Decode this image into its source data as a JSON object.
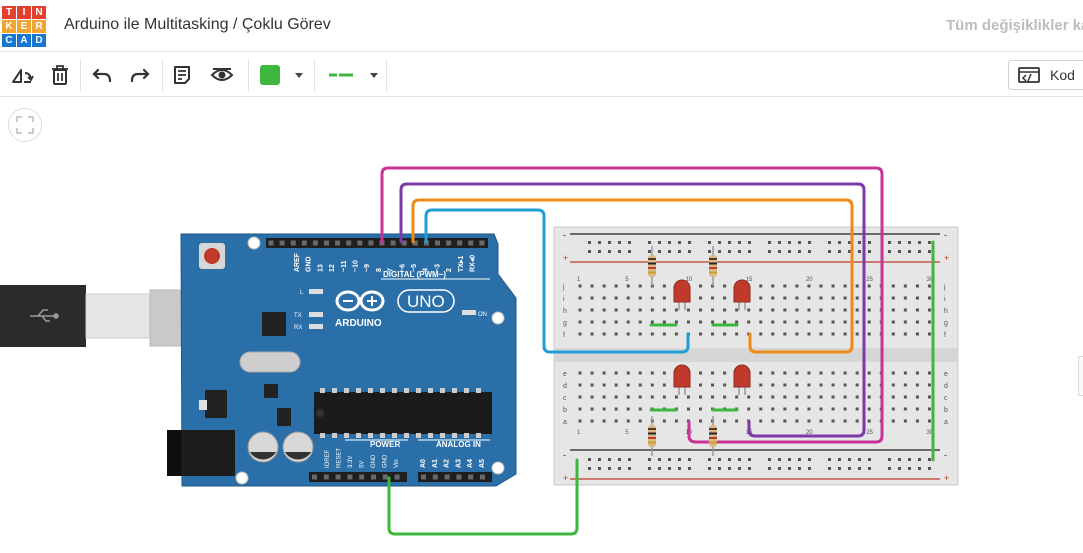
{
  "header": {
    "logo_letters": [
      "T",
      "I",
      "N",
      "K",
      "E",
      "R",
      "C",
      "A",
      "D"
    ],
    "logo_colors": [
      "#e2412f",
      "#e2412f",
      "#e2412f",
      "#f0a530",
      "#f0a530",
      "#f0a530",
      "#1477d1",
      "#1477d1",
      "#1477d1"
    ],
    "title": "Arduino ile Multitasking / Çoklu Görev",
    "save_status": "Tüm değişiklikler ka"
  },
  "toolbar": {
    "tools": [
      {
        "name": "rotate-icon"
      },
      {
        "name": "trash-icon"
      },
      {
        "name": "undo-icon"
      },
      {
        "name": "redo-icon"
      },
      {
        "name": "notes-icon"
      },
      {
        "name": "eye-icon"
      }
    ],
    "wire_color": "#3fb73f",
    "wire_style": "line-icon",
    "code_label": "Kod"
  },
  "arduino": {
    "board_color": "#2a6fa8",
    "label_brand": "ARDUINO",
    "label_model": "UNO",
    "header_digital": "DIGITAL (PWM~)",
    "digital_pins": [
      "AREF",
      "GND",
      "13",
      "12",
      "~11",
      "~10",
      "~9",
      "8",
      "7",
      "~6",
      "~5",
      "4",
      "~3",
      "2",
      "TX▸1",
      "RX◂0"
    ],
    "header_power": "POWER",
    "power_pins": [
      "IOREF",
      "RESET",
      "3.3V",
      "5V",
      "GND",
      "GND",
      "Vin"
    ],
    "header_analog": "ANALOG IN",
    "analog_pins": [
      "A0",
      "A1",
      "A2",
      "A3",
      "A4",
      "A5"
    ],
    "led_labels": [
      "L",
      "TX",
      "RX"
    ],
    "on_label": "ON"
  },
  "breadboard": {
    "row_letters_top": [
      "j",
      "i",
      "h",
      "g",
      "f"
    ],
    "row_letters_bottom": [
      "e",
      "d",
      "c",
      "b",
      "a"
    ],
    "column_numbers": [
      "1",
      "5",
      "10",
      "15",
      "20",
      "25",
      "30"
    ],
    "rail_plus": "+",
    "rail_minus": "-"
  },
  "wires": {
    "magenta": "#c8339a",
    "purple": "#7b3aa8",
    "orange": "#ee8a17",
    "blue": "#1f9fd4",
    "green": "#3fb73f"
  }
}
